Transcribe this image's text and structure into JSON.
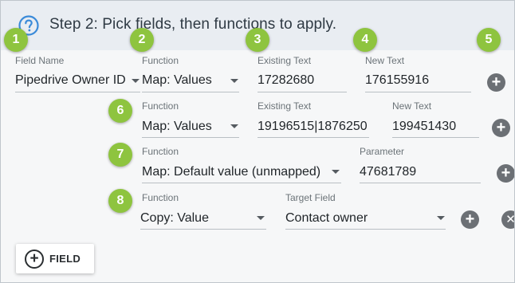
{
  "step_title": "Step 2: Pick fields, then functions to apply.",
  "icons": {
    "help": "help-circle-icon",
    "add": "plus-circle-icon",
    "remove": "close-circle-icon",
    "dropdown": "chevron-down-icon"
  },
  "colors": {
    "badge": "#8ec43f",
    "header_bg": "#e9edf2",
    "help_icon": "#3b8bd9",
    "action_button": "#6c7075"
  },
  "badges": [
    "1",
    "2",
    "3",
    "4",
    "5",
    "6",
    "7",
    "8"
  ],
  "field": {
    "label": "Field Name",
    "value": "Pipedrive Owner ID"
  },
  "rows": [
    {
      "function_label": "Function",
      "function_value": "Map: Values",
      "existing_label": "Existing Text",
      "existing_value": "17282680",
      "new_label": "New Text",
      "new_value": "176155916"
    },
    {
      "function_label": "Function",
      "function_value": "Map: Values",
      "existing_label": "Existing Text",
      "existing_value": "19196515|1876250",
      "new_label": "New Text",
      "new_value": "199451430"
    },
    {
      "function_label": "Function",
      "function_value": "Map: Default value (unmapped)",
      "param_label": "Parameter",
      "param_value": "47681789"
    },
    {
      "function_label": "Function",
      "function_value": "Copy: Value",
      "target_label": "Target Field",
      "target_value": "Contact owner"
    }
  ],
  "add_symbol": "+",
  "remove_symbol": "✕",
  "field_button": {
    "symbol": "+",
    "label": "FIELD"
  }
}
